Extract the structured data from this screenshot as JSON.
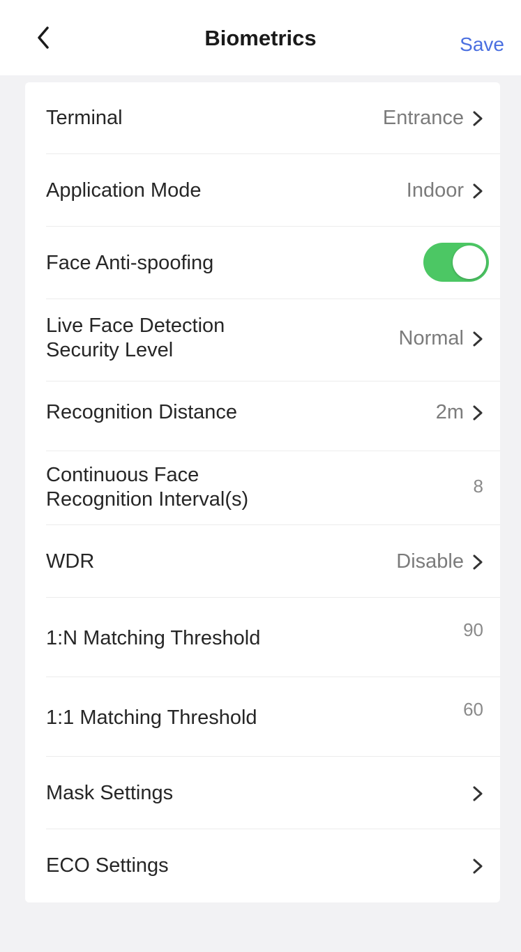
{
  "header": {
    "title": "Biometrics",
    "save_label": "Save",
    "back_icon": "chevron-left-icon"
  },
  "colors": {
    "accent": "#4a6fe0",
    "toggle_on": "#4cc764"
  },
  "settings": [
    {
      "label": "Terminal",
      "value": "Entrance",
      "chevron": true
    },
    {
      "label": "Application Mode",
      "value": "Indoor",
      "chevron": true
    },
    {
      "label": "Face Anti-spoofing",
      "toggle": true,
      "enabled": true
    },
    {
      "label_line1": "Live Face Detection",
      "label_line2": "Security Level",
      "value": "Normal",
      "chevron": true
    },
    {
      "label": "Recognition Distance",
      "value": "2m",
      "chevron": true
    },
    {
      "label_line1": "Continuous Face",
      "label_line2": "Recognition Interval(s)",
      "value": "8"
    },
    {
      "label": "WDR",
      "value": "Disable",
      "chevron": true
    },
    {
      "label": "1:N Matching Threshold",
      "value": "90"
    },
    {
      "label": "1:1 Matching Threshold",
      "value": "60"
    },
    {
      "label": "Mask Settings",
      "chevron": true
    },
    {
      "label": "ECO Settings",
      "chevron": true
    }
  ]
}
